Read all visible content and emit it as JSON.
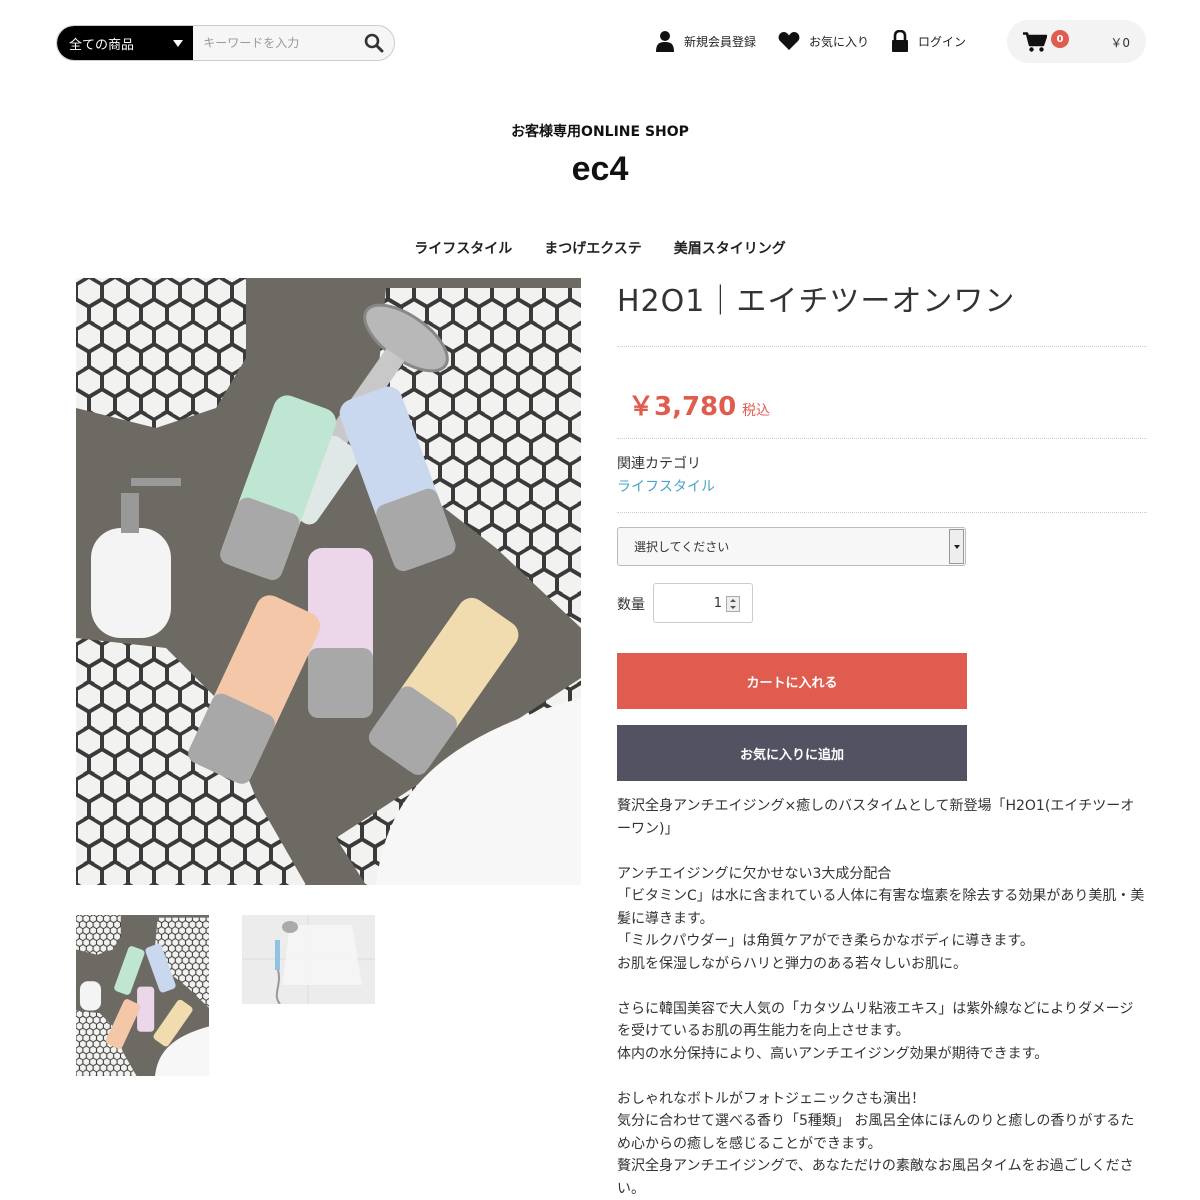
{
  "header": {
    "category_select": "全ての商品",
    "search_placeholder": "キーワードを入力",
    "register": "新規会員登録",
    "favorites": "お気に入り",
    "login": "ログイン",
    "cart_count": "0",
    "cart_total": "￥0"
  },
  "shop": {
    "subtitle": "お客様専用ONLINE SHOP",
    "logo": "ec4"
  },
  "global_nav": [
    "ライフスタイル",
    "まつげエクステ",
    "美眉スタイリング"
  ],
  "product": {
    "name": "H2O1｜エイチツーオンワン",
    "price": "￥3,780",
    "tax_label": "税込",
    "related_category_label": "関連カテゴリ",
    "related_category": "ライフスタイル",
    "variant_placeholder": "選択してください",
    "quantity_label": "数量",
    "quantity": "1",
    "add_to_cart": "カートに入れる",
    "add_to_favorites": "お気に入りに追加",
    "description": [
      "贅沢全身アンチエイジング×癒しのバスタイムとして新登場「H2O1(エイチツーオーワン)」",
      "アンチエイジングに欠かせない3大成分配合\n「ビタミンC」は水に含まれている人体に有害な塩素を除去する効果があり美肌・美髪に導きます。\n「ミルクパウダー」は角質ケアができ柔らかなボディに導きます。\nお肌を保湿しながらハリと弾力のある若々しいお肌に。",
      "さらに韓国美容で大人気の「カタツムリ粘液エキス」は紫外線などによりダメージを受けているお肌の再生能力を向上させます。\n体内の水分保持により、高いアンチエイジング効果が期待できます。",
      "おしゃれなボトルがフォトジェニックさも演出！\n気分に合わせて選べる香り「5種類」 お風呂全体にほんのりと癒しの香りがするため心からの癒しを感じることができます。\n贅沢全身アンチエイジングで、あなただけの素敵なお風呂タイムをお過ごしください。"
    ]
  },
  "colors": {
    "accent": "#e05c4f",
    "favorite_button": "#525263",
    "link": "#4aa3c8"
  }
}
